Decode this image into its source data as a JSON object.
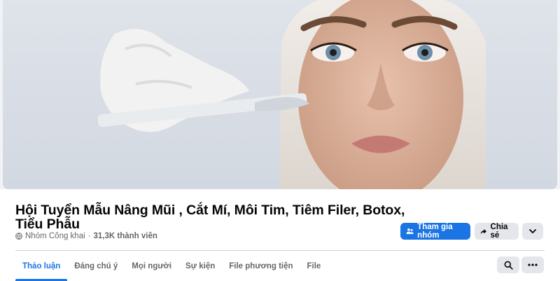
{
  "group": {
    "title": "Hội Tuyển Mẫu Nâng Mũi , Cắt Mí, Môi Tim, Tiêm Filer, Botox, Tiểu Phẫu",
    "privacy": "Nhóm Công khai",
    "separator": "·",
    "members": "31,3K thành viên"
  },
  "actions": {
    "join_label": "Tham gia nhóm",
    "share_label": "Chia sẻ"
  },
  "tabs": [
    {
      "label": "Thảo luận",
      "active": true
    },
    {
      "label": "Đáng chú ý",
      "active": false
    },
    {
      "label": "Mọi người",
      "active": false
    },
    {
      "label": "Sự kiện",
      "active": false
    },
    {
      "label": "File phương tiện",
      "active": false
    },
    {
      "label": "File",
      "active": false
    }
  ],
  "icons": {
    "privacy": "globe-icon",
    "join": "people-icon",
    "share": "share-arrow-icon",
    "more": "chevron-down-icon",
    "search": "search-icon",
    "menu": "more-dots-icon"
  },
  "colors": {
    "accent": "#1b74e4",
    "secondary_button": "#e4e6eb",
    "muted_text": "#65676b"
  }
}
